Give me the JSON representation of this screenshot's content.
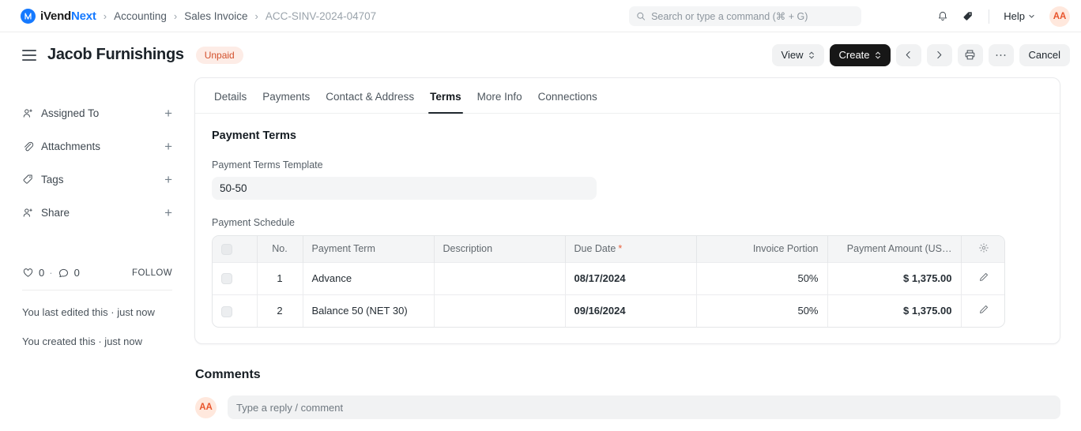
{
  "navbar": {
    "brand_prefix": "iVend",
    "brand_suffix": "Next",
    "breadcrumbs": [
      {
        "label": "Accounting",
        "muted": false
      },
      {
        "label": "Sales Invoice",
        "muted": false
      },
      {
        "label": "ACC-SINV-2024-04707",
        "muted": true
      }
    ],
    "search_placeholder": "Search or type a command (⌘ + G)",
    "search_value": "",
    "notifications_icon": "bell-icon",
    "tags_icon": "tag-icon",
    "help_label": "Help",
    "avatar_initials": "AA"
  },
  "header": {
    "menu_icon": "hamburger-icon",
    "title": "Jacob Furnishings",
    "status": "Unpaid",
    "status_bg": "#fdece6",
    "status_color": "#d3502c",
    "actions": {
      "view_label": "View",
      "create_label": "Create",
      "prev_icon": "chevron-left-icon",
      "next_icon": "chevron-right-icon",
      "print_icon": "printer-icon",
      "more_icon": "ellipsis-icon",
      "cancel_label": "Cancel"
    }
  },
  "sidebar": {
    "items": [
      {
        "label": "Assigned To",
        "icon": "user-plus-icon",
        "action": "+"
      },
      {
        "label": "Attachments",
        "icon": "paperclip-icon",
        "action": "+"
      },
      {
        "label": "Tags",
        "icon": "tag-icon",
        "action": "+"
      },
      {
        "label": "Share",
        "icon": "user-plus-icon",
        "action": "+"
      }
    ],
    "likes_count": "0",
    "separator_dot": "·",
    "comments_count": "0",
    "follow_label": "FOLLOW",
    "edited_note": "You last edited this · just now",
    "created_note": "You created this · just now"
  },
  "tabs": [
    {
      "label": "Details",
      "active": false
    },
    {
      "label": "Payments",
      "active": false
    },
    {
      "label": "Contact & Address",
      "active": false
    },
    {
      "label": "Terms",
      "active": true
    },
    {
      "label": "More Info",
      "active": false
    },
    {
      "label": "Connections",
      "active": false
    }
  ],
  "terms": {
    "section_title": "Payment Terms",
    "template_label": "Payment Terms Template",
    "template_value": "50-50",
    "schedule_label": "Payment Schedule",
    "table": {
      "columns": [
        {
          "key": "check",
          "label": "",
          "required": false
        },
        {
          "key": "no",
          "label": "No.",
          "required": false
        },
        {
          "key": "term",
          "label": "Payment Term",
          "required": false
        },
        {
          "key": "description",
          "label": "Description",
          "required": false
        },
        {
          "key": "due_date",
          "label": "Due Date",
          "required": true
        },
        {
          "key": "portion",
          "label": "Invoice Portion",
          "required": false
        },
        {
          "key": "amount",
          "label": "Payment Amount (US…",
          "required": false
        },
        {
          "key": "settings",
          "label": "",
          "required": false
        }
      ],
      "settings_icon": "gear-icon",
      "rows": [
        {
          "no": "1",
          "term": "Advance",
          "description": "",
          "due_date": "08/17/2024",
          "portion": "50%",
          "amount": "$ 1,375.00",
          "edit_icon": "pencil-icon"
        },
        {
          "no": "2",
          "term": "Balance 50 (NET 30)",
          "description": "",
          "due_date": "09/16/2024",
          "portion": "50%",
          "amount": "$ 1,375.00",
          "edit_icon": "pencil-icon"
        }
      ]
    }
  },
  "comments": {
    "title": "Comments",
    "avatar_initials": "AA",
    "placeholder": "Type a reply / comment",
    "value": ""
  }
}
